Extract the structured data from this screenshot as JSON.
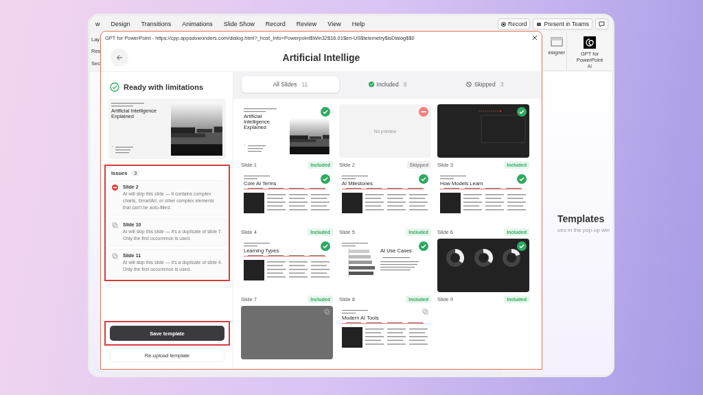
{
  "ribbon": {
    "tabs": [
      "w",
      "Design",
      "Transitions",
      "Animations",
      "Slide Show",
      "Record",
      "Review",
      "View",
      "Help"
    ],
    "record_button": "Record",
    "present_button": "Present in Teams",
    "left_group": [
      "Lay",
      "Res",
      "Sec"
    ],
    "designer_label": "esigner",
    "addin_label": "GPT for PowerPoint",
    "group_label": "AI"
  },
  "document": {
    "heading": "Templates",
    "text": "ues in the pop-up win"
  },
  "dialog": {
    "title_bar": "GPT for PowerPoint - https://cpp.appsdowonders.com/dialog.html?_host_Info=Powerpoint$Win32$16.01$en-US$telemetry$isDialog$$0",
    "header_title": "Artificial Intellige",
    "status": "Ready with limitations",
    "preview": {
      "kind": "title",
      "title": "Artificial Intelligence Explained"
    },
    "issues": {
      "label": "Issues",
      "count": "3",
      "items": [
        {
          "kind": "error",
          "title": "Slide 2",
          "text": "AI will skip this slide — it contains complex charts, SmartArt, or other complex elements that can't be auto-filled."
        },
        {
          "kind": "duplicate",
          "title": "Slide 10",
          "text": "AI will skip this slide — it's a duplicate of slide 7. Only the first occurrence is used."
        },
        {
          "kind": "duplicate",
          "title": "Slide 11",
          "text": "AI will skip this slide — it's a duplicate of slide 4. Only the first occurrence is used."
        }
      ]
    },
    "save_button": "Save template",
    "reupload_button": "Re-upload template",
    "filter_tabs": [
      {
        "label": "All Slides",
        "count": "11",
        "selected": true
      },
      {
        "label": "Included",
        "count": "8",
        "selected": false
      },
      {
        "label": "Skipped",
        "count": "3",
        "selected": false
      }
    ],
    "slides": [
      {
        "label": "Slide 1",
        "status": "Included",
        "included": true,
        "preview": {
          "kind": "title",
          "title": "Artificial Intelligence Explained"
        }
      },
      {
        "label": "Slide 2",
        "status": "Skipped",
        "included": false,
        "preview": {
          "kind": "empty",
          "text": "No preview"
        }
      },
      {
        "label": "Slide 3",
        "status": "Included",
        "included": true,
        "preview": {
          "kind": "dark"
        }
      },
      {
        "label": "Slide 4",
        "status": "Included",
        "included": true,
        "preview": {
          "kind": "columns",
          "title": "Core AI Terms"
        }
      },
      {
        "label": "Slide 5",
        "status": "Included",
        "included": true,
        "preview": {
          "kind": "columns",
          "title": "AI Milestones"
        }
      },
      {
        "label": "Slide 6",
        "status": "Included",
        "included": true,
        "preview": {
          "kind": "columns",
          "title": "How Models Learn"
        }
      },
      {
        "label": "Slide 7",
        "status": "Included",
        "included": true,
        "preview": {
          "kind": "columns",
          "title": "Learning Types"
        }
      },
      {
        "label": "Slide 8",
        "status": "Included",
        "included": true,
        "preview": {
          "kind": "chart",
          "title": "AI Use Cases"
        }
      },
      {
        "label": "Slide 9",
        "status": "Included",
        "included": true,
        "preview": {
          "kind": "donuts"
        }
      },
      {
        "duplicate": true,
        "preview": {
          "kind": "grey"
        }
      },
      {
        "duplicate": true,
        "preview": {
          "kind": "columns",
          "title": "Modern AI Tools"
        }
      }
    ]
  }
}
